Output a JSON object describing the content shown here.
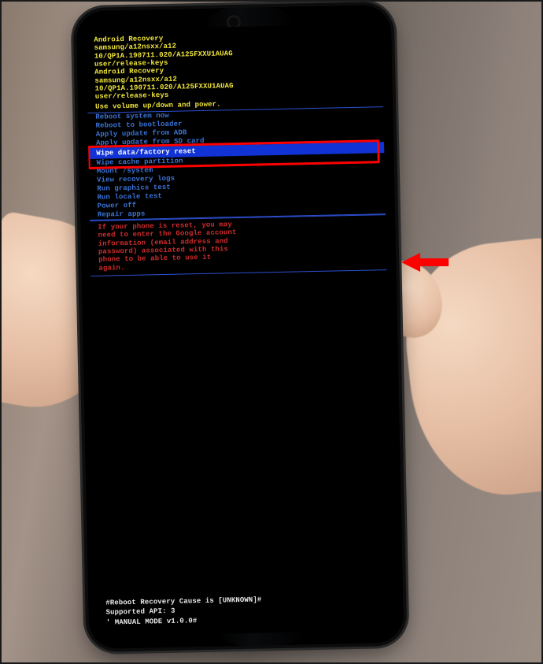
{
  "header": {
    "lines": [
      "Android Recovery",
      "samsung/a12nsxx/a12",
      "10/QP1A.190711.020/A125FXXU1AUAG",
      "user/release-keys",
      "Android Recovery",
      "samsung/a12nsxx/a12",
      "10/QP1A.190711.020/A125FXXU1AUAG",
      "user/release-keys"
    ],
    "instruction": "Use volume up/down and power."
  },
  "menu": {
    "items": [
      "Reboot system now",
      "Reboot to bootloader",
      "Apply update from ADB",
      "Apply update from SD card",
      "Wipe data/factory reset",
      "Wipe cache partition",
      "Mount /system",
      "View recovery logs",
      "Run graphics test",
      "Run locale test",
      "Power off",
      "Repair apps"
    ],
    "selected_index": 4
  },
  "warning": "If your phone is reset, you may\nneed to enter the Google account\ninformation (email address and\npassword) associated with this\nphone to be able to use it\nagain.",
  "footer": {
    "line1": "#Reboot Recovery Cause is [UNKNOWN]#",
    "line2": "Supported API: 3",
    "line3": "' MANUAL MODE v1.0.0#"
  },
  "annotation": {
    "arrow_color": "#ff0000",
    "highlight_color": "#ff0000"
  }
}
